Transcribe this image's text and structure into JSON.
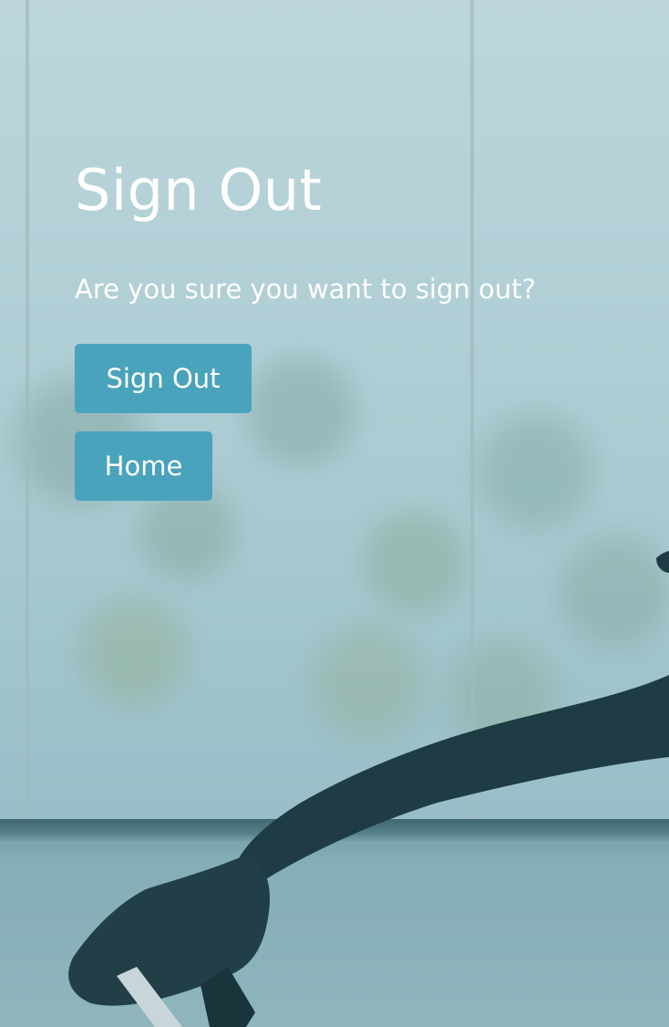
{
  "page": {
    "title": "Sign Out",
    "message": "Are you sure you want to sign out?"
  },
  "actions": {
    "sign_out_label": "Sign Out",
    "home_label": "Home"
  },
  "colors": {
    "button_background": "#4aa3bc",
    "text": "#ffffff",
    "background_tint": "#b3d0d7",
    "figure": "#1f3c44"
  }
}
